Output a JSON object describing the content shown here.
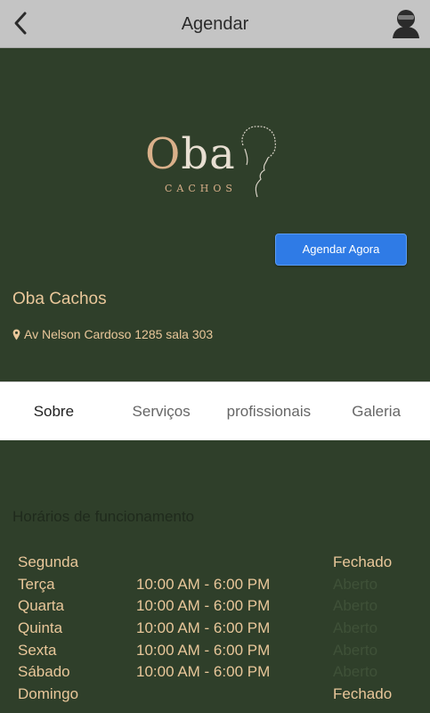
{
  "header": {
    "title": "Agendar"
  },
  "business": {
    "logo_main_initial": "O",
    "logo_main_rest": "ba",
    "logo_sub": "CACHOS",
    "name": "Oba Cachos",
    "address": "Av Nelson Cardoso 1285 sala 303",
    "cta_label": "Agendar Agora"
  },
  "tabs": [
    {
      "label": "Sobre",
      "active": true
    },
    {
      "label": "Serviços",
      "active": false
    },
    {
      "label": "profissionais",
      "active": false
    },
    {
      "label": "Galeria",
      "active": false
    }
  ],
  "hours": {
    "title": "Horários de funcionamento",
    "rows": [
      {
        "day": "Segunda",
        "time": "",
        "status": "Fechado"
      },
      {
        "day": "Terça",
        "time": "10:00 AM - 6:00 PM",
        "status": "Aberto"
      },
      {
        "day": "Quarta",
        "time": "10:00 AM - 6:00 PM",
        "status": "Aberto"
      },
      {
        "day": "Quinta",
        "time": "10:00 AM - 6:00 PM",
        "status": "Aberto"
      },
      {
        "day": "Sexta",
        "time": "10:00 AM - 6:00 PM",
        "status": "Aberto"
      },
      {
        "day": "Sábado",
        "time": "10:00 AM - 6:00 PM",
        "status": "Aberto"
      },
      {
        "day": "Domingo",
        "time": "",
        "status": "Fechado"
      }
    ]
  },
  "colors": {
    "background": "#2f3f2a",
    "accent_text": "#e9c79a",
    "cta": "#2f7be6",
    "header": "#c4c4c4"
  },
  "icons": {
    "back": "chevron-left-icon",
    "user": "user-avatar-icon",
    "location": "map-pin-icon"
  }
}
